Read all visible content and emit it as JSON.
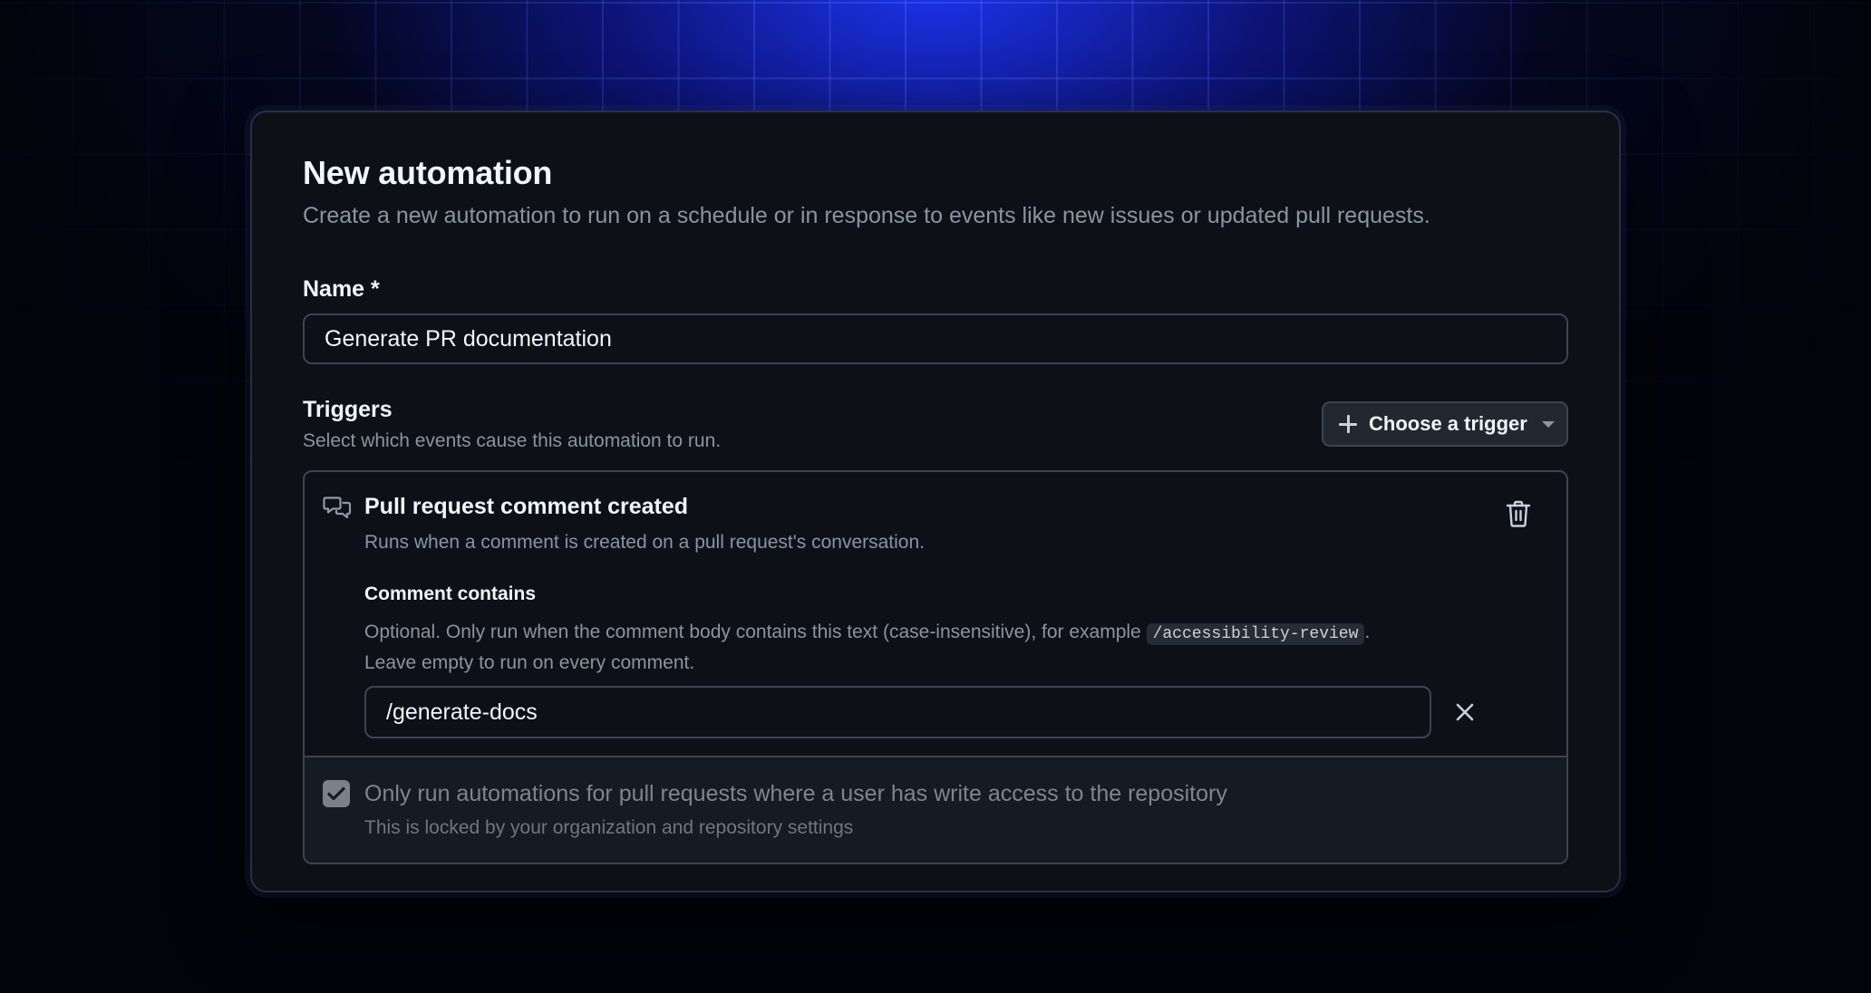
{
  "form": {
    "title": "New automation",
    "subtitle": "Create a new automation to run on a schedule or in response to events like new issues or updated pull requests.",
    "name": {
      "label": "Name *",
      "value": "Generate PR documentation"
    },
    "triggers": {
      "label": "Triggers",
      "description": "Select which events cause this automation to run.",
      "choose_button_label": "Choose a trigger",
      "choose_button_icon": "plus-icon",
      "items": [
        {
          "icon": "comment-discussion-icon",
          "title": "Pull request comment created",
          "description": "Runs when a comment is created on a pull request's conversation.",
          "delete_icon": "trash-icon",
          "comment_contains": {
            "label": "Comment contains",
            "help_before": "Optional. Only run when the comment body contains this text (case-insensitive), for example ",
            "help_code": "/accessibility-review",
            "help_after": ".",
            "help_line2": "Leave empty to run on every comment.",
            "value": "/generate-docs",
            "clear_icon": "x-icon"
          },
          "write_access": {
            "checked": true,
            "locked": true,
            "label": "Only run automations for pull requests where a user has write access to the repository",
            "note": "This is locked by your organization and repository settings"
          }
        }
      ]
    }
  },
  "colors": {
    "background": "#02040b",
    "glow": "#1e37ff",
    "panel": "#0d1117",
    "border": "#3d444d",
    "text_primary": "#f0f6fc",
    "text_muted": "#8b949e"
  }
}
